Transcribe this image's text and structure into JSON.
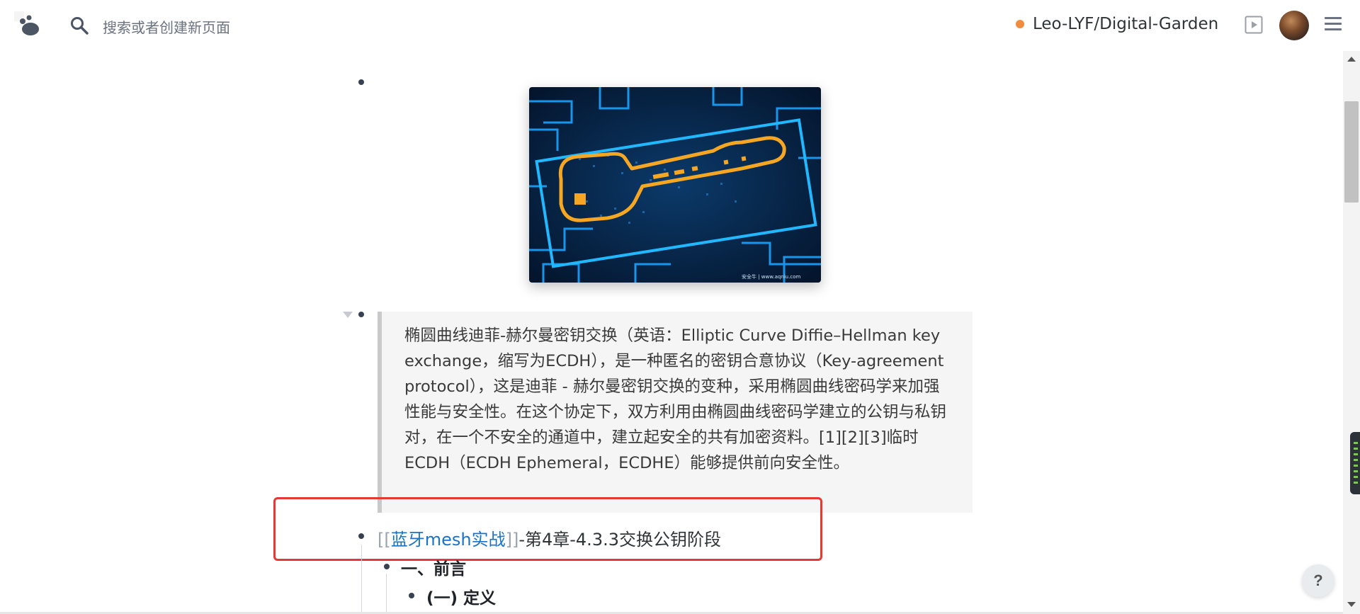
{
  "header": {
    "search_placeholder": "搜索或者创建新页面",
    "repo_status_color": "#f08c3e",
    "repo_name": "Leo-LYF/Digital-Garden",
    "icons": [
      "logo-icon",
      "search-icon",
      "play-icon",
      "avatar",
      "menu-icon"
    ]
  },
  "main": {
    "image_block": {
      "watermark": "安全牛 | www.aqniu.com"
    },
    "quote_text": "椭圆曲线迪菲-赫尔曼密钥交换（英语：Elliptic Curve Diffie–Hellman key exchange，缩写为ECDH），是一种匿名的密钥合意协议（Key-agreement protocol），这是迪菲 - 赫尔曼密钥交换的变种，采用椭圆曲线密码学来加强性能与安全性。在这个协定下，双方利用由椭圆曲线密码学建立的公钥与私钥对，在一个不安全的通道中，建立起安全的共有加密资料。[1][2][3]临时ECDH（ECDH Ephemeral，ECDHE）能够提供前向安全性。",
    "ref": {
      "open_bracket": "[[",
      "link_text": "蓝牙mesh实战",
      "close_bracket": "]]",
      "suffix": "-第4章-4.3.3交换公钥阶段"
    },
    "heading1": "一、前言",
    "heading2": "(一) 定义",
    "highlight_color": "#e53935"
  },
  "help_label": "?"
}
